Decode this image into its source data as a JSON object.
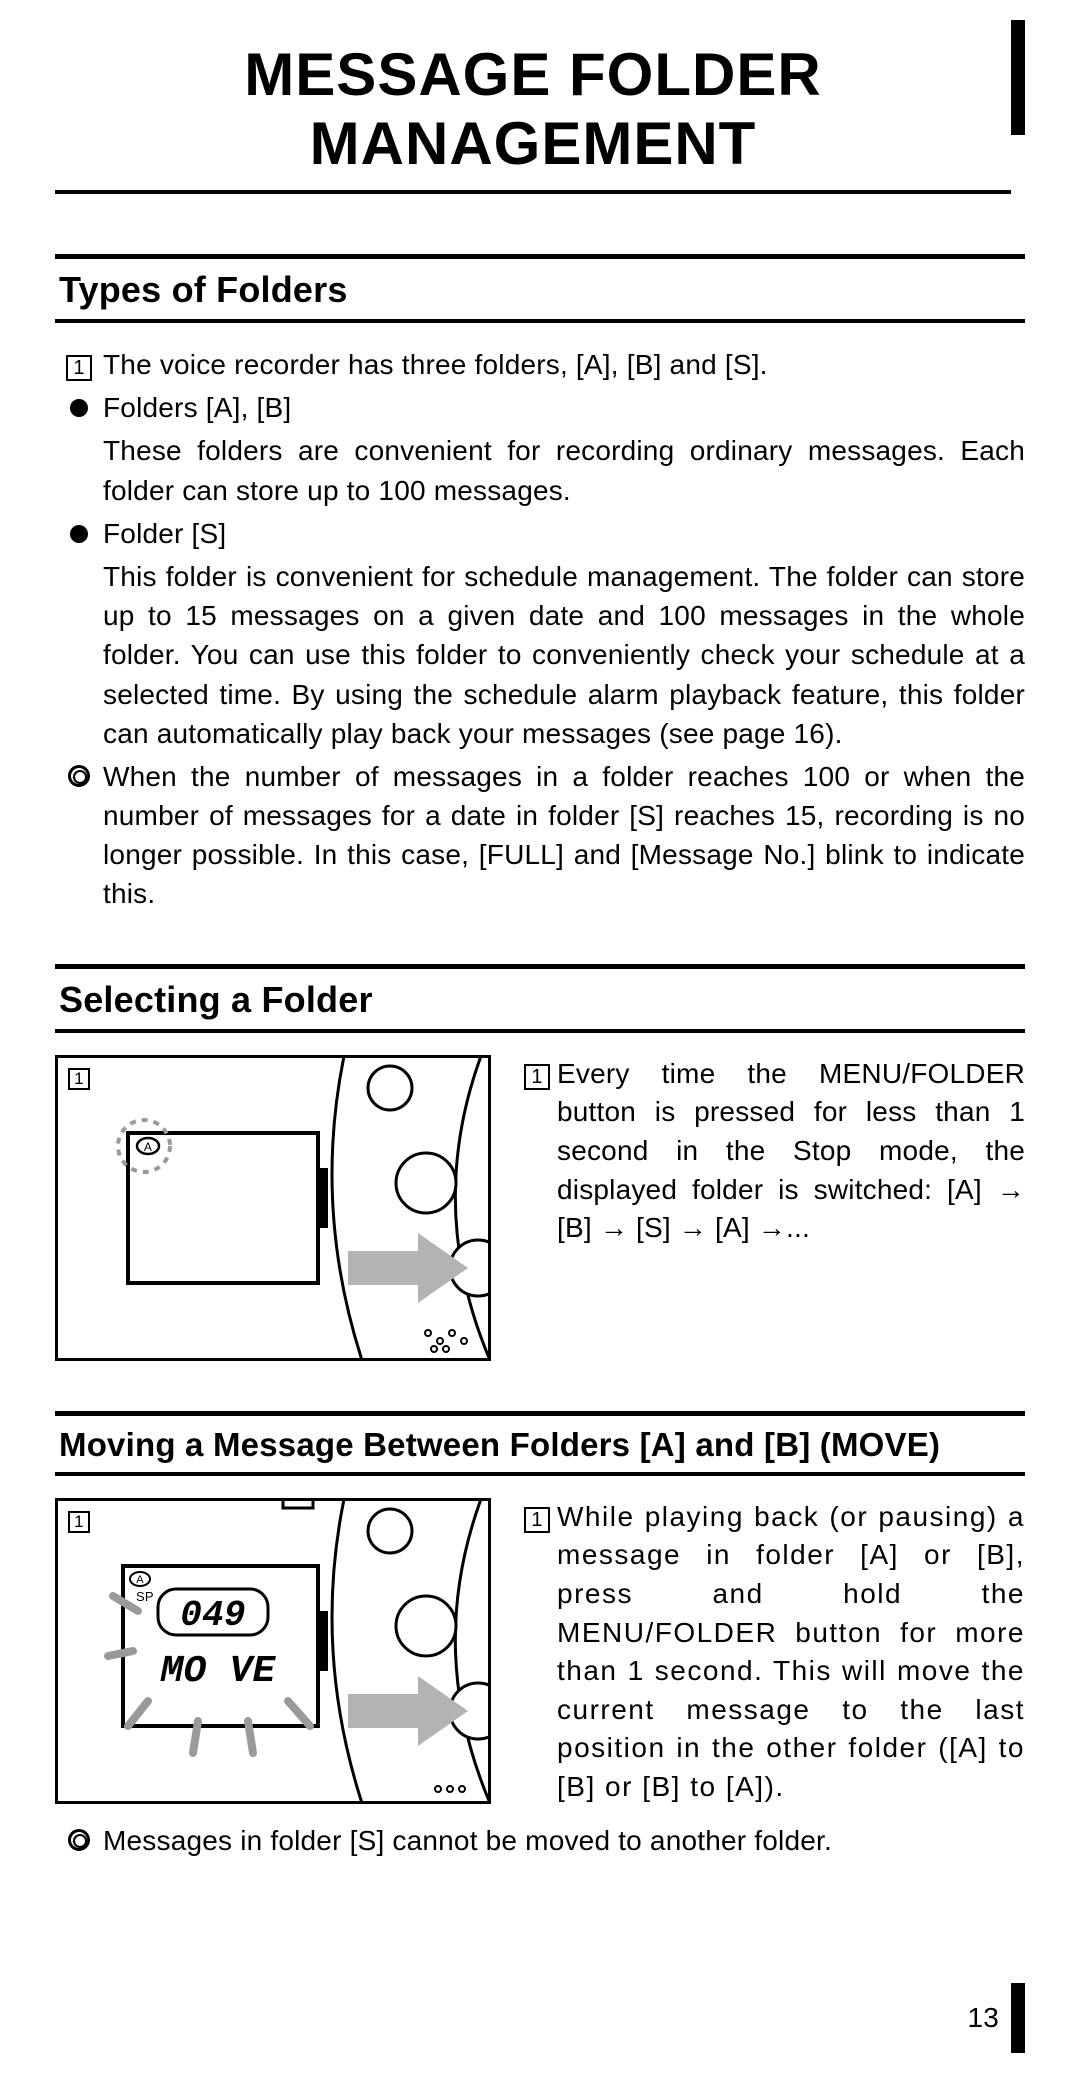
{
  "title": "MESSAGE FOLDER MANAGEMENT",
  "page_number": "13",
  "section1": {
    "heading": "Types of Folders",
    "step1_num": "1",
    "step1_text": "The voice recorder has three folders, [A], [B] and [S].",
    "bul_ab_title": "Folders [A], [B]",
    "bul_ab_body": "These folders are convenient for recording ordinary messages. Each folder can store up to 100 messages.",
    "bul_s_title": "Folder [S]",
    "bul_s_body": "This folder is convenient for schedule management. The folder can store up to 15 messages on a given date and 100 messages in the whole folder. You can use this folder to conveniently check your schedule at a selected time. By using the schedule alarm playback feature, this folder can automatically play back your messages (see page 16).",
    "note_body": "When the number of messages in a folder reaches 100 or when the number of messages for a date in folder [S] reaches 15, recording is no longer possible. In this case, [FULL] and [Message No.] blink to indicate this."
  },
  "section2": {
    "heading": "Selecting a Folder",
    "step1_num": "1",
    "illus_step": "1",
    "step1_text": "Every time the MENU/FOLDER button is pressed for less than 1 second in the Stop mode, the displayed folder is switched: [A] → [B] → [S] → [A] →..."
  },
  "section3": {
    "heading": "Moving a Message Between Folders [A] and [B]  (MOVE)",
    "step1_num": "1",
    "illus_step": "1",
    "step1_text": "While playing back (or pausing) a message in folder [A] or [B], press and hold the MENU/FOLDER button for more than 1 second. This will move the current message to the last position in the other folder ([A] to [B] or [B] to [A]).",
    "note_body": "Messages in folder [S] cannot be moved to another folder.",
    "lcd_num": "049",
    "lcd_text": "MO VE",
    "lcd_folder": "A",
    "lcd_mode": "SP"
  }
}
